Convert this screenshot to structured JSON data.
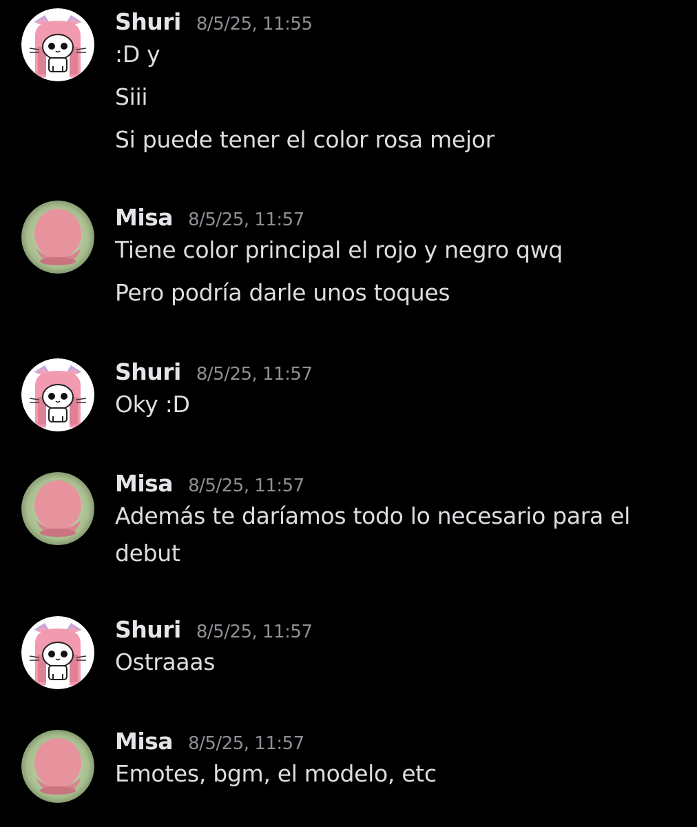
{
  "conversation": {
    "groups": [
      {
        "author": "Shuri",
        "avatar_icon": "pink-cat-avatar-icon",
        "timestamp": "8/5/25, 11:55",
        "lines": [
          ":D y",
          "Siii",
          "Si puede tener el color rosa mejor"
        ]
      },
      {
        "author": "Misa",
        "avatar_icon": "pink-blob-avatar-icon",
        "timestamp": "8/5/25, 11:57",
        "lines": [
          "Tiene color principal el rojo y negro qwq",
          "Pero podría darle unos toques"
        ]
      },
      {
        "author": "Shuri",
        "avatar_icon": "pink-cat-avatar-icon",
        "timestamp": "8/5/25, 11:57",
        "lines": [
          "Oky :D"
        ]
      },
      {
        "author": "Misa",
        "avatar_icon": "pink-blob-avatar-icon",
        "timestamp": "8/5/25, 11:57",
        "lines": [
          "Además te daríamos todo lo necesario para el",
          "debut"
        ]
      },
      {
        "author": "Shuri",
        "avatar_icon": "pink-cat-avatar-icon",
        "timestamp": "8/5/25, 11:57",
        "lines": [
          "Ostraaas"
        ]
      },
      {
        "author": "Misa",
        "avatar_icon": "pink-blob-avatar-icon",
        "timestamp": "8/5/25, 11:57",
        "lines": [
          "Emotes, bgm, el modelo, etc"
        ]
      }
    ]
  },
  "colors": {
    "background": "#000000",
    "username": "#e3e5e8",
    "timestamp": "#8d9096",
    "message_text": "#dbdee1"
  }
}
